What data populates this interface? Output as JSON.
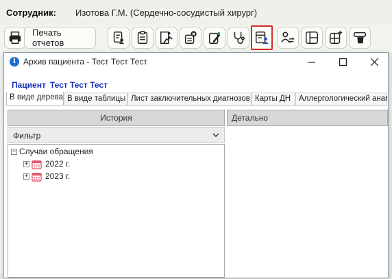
{
  "header": {
    "employee_label": "Сотрудник:",
    "employee_name": "Изотова Г.М. (Сердечно-сосудистый хирург)"
  },
  "toolbar": {
    "print_reports_label": "Печать отчетов",
    "buttons": [
      {
        "icon": "printer-icon"
      },
      {
        "icon": "document-user-icon"
      },
      {
        "icon": "clipboard-icon"
      },
      {
        "icon": "run-icon"
      },
      {
        "icon": "cancel-stamp-icon"
      },
      {
        "icon": "edit-card-icon"
      },
      {
        "icon": "stethoscope-icon"
      },
      {
        "icon": "patient-archive-icon",
        "selected": true
      },
      {
        "icon": "user-transfer-icon"
      },
      {
        "icon": "layout-grid-icon"
      },
      {
        "icon": "add-grid-icon"
      },
      {
        "icon": "delete-icon"
      }
    ],
    "selected_border_color": "#d42a2a"
  },
  "dialog": {
    "title": "Архив пациента - Тест Тест Тест",
    "patient_label": "Пациент",
    "patient_name": "Тест Тест Тест",
    "tabs": [
      {
        "label": "В виде дерева",
        "active": true
      },
      {
        "label": "В виде таблицы"
      },
      {
        "label": "Лист заключительных диагнозов"
      },
      {
        "label": "Карты ДН"
      },
      {
        "label": "Аллергологический анамн"
      }
    ],
    "history_header": "История",
    "filter_label": "Фильтр",
    "detail_header": "Детально",
    "tree": {
      "root_label": "Случаи обращения",
      "children": [
        {
          "label": "2022 г."
        },
        {
          "label": "2023 г."
        }
      ]
    }
  },
  "colors": {
    "accent_blue": "#1530b8",
    "calendar_red": "#e0566a"
  }
}
